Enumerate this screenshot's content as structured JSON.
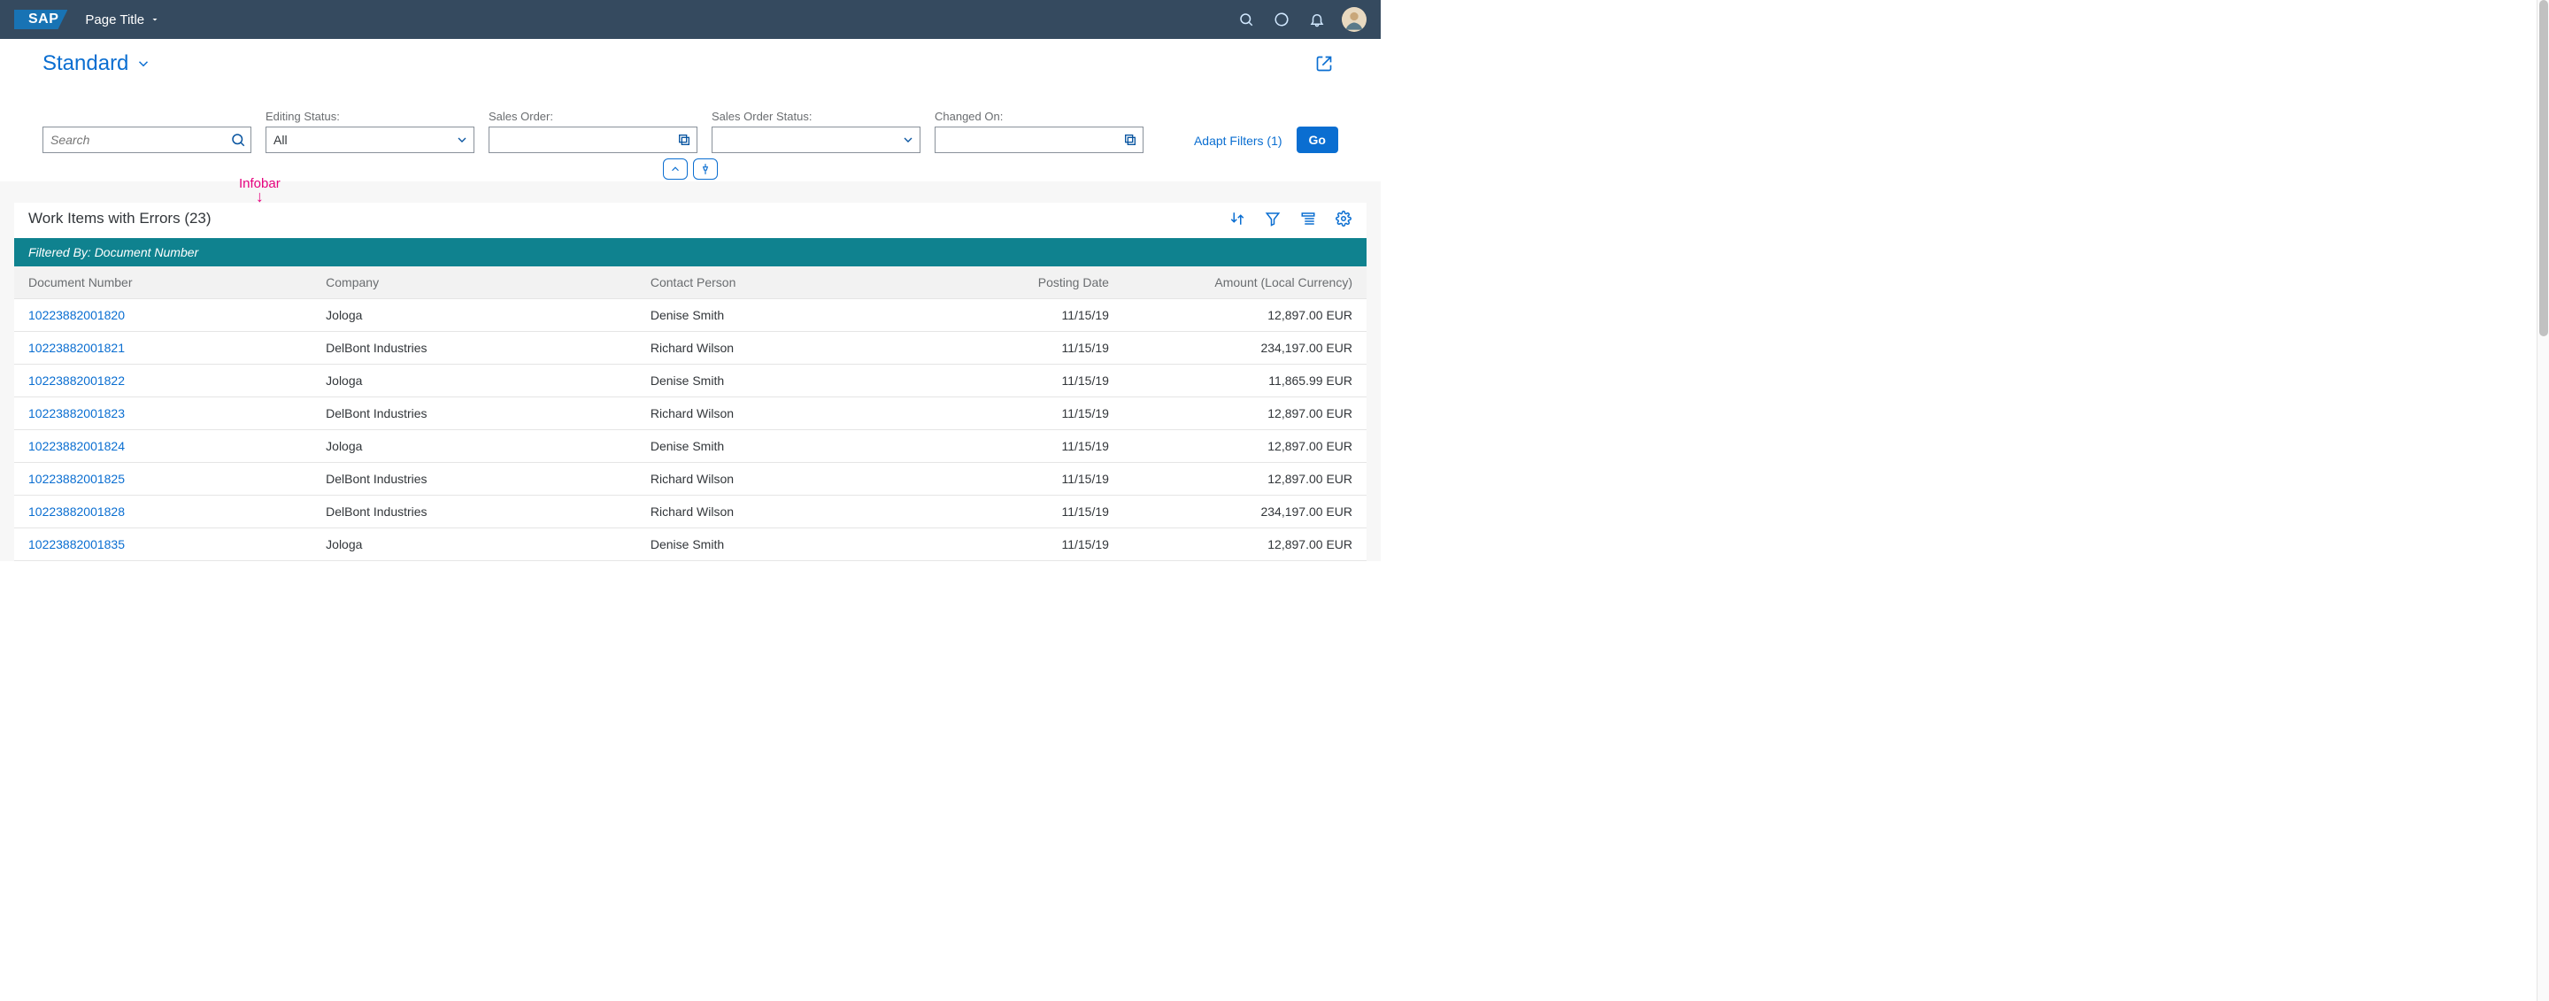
{
  "shell": {
    "logo_text": "SAP",
    "page_title": "Page Title"
  },
  "header": {
    "variant": "Standard",
    "adapt_filters": "Adapt Filters (1)",
    "go": "Go"
  },
  "filters": {
    "search_placeholder": "Search",
    "editing_status_label": "Editing Status:",
    "editing_status_value": "All",
    "sales_order_label": "Sales Order:",
    "sales_order_status_label": "Sales Order Status:",
    "changed_on_label": "Changed On:"
  },
  "annotation": {
    "label": "Infobar"
  },
  "table": {
    "title": "Work Items with Errors (23)",
    "infobar": "Filtered By: Document Number",
    "columns": {
      "doc": "Document Number",
      "company": "Company",
      "contact": "Contact Person",
      "date": "Posting Date",
      "amount": "Amount (Local Currency)"
    },
    "rows": [
      {
        "doc": "10223882001820",
        "company": "Jologa",
        "contact": "Denise Smith",
        "date": "11/15/19",
        "amount": "12,897.00 EUR"
      },
      {
        "doc": "10223882001821",
        "company": "DelBont Industries",
        "contact": "Richard Wilson",
        "date": "11/15/19",
        "amount": "234,197.00 EUR"
      },
      {
        "doc": "10223882001822",
        "company": "Jologa",
        "contact": "Denise Smith",
        "date": "11/15/19",
        "amount": "11,865.99 EUR"
      },
      {
        "doc": "10223882001823",
        "company": "DelBont Industries",
        "contact": "Richard Wilson",
        "date": "11/15/19",
        "amount": "12,897.00 EUR"
      },
      {
        "doc": "10223882001824",
        "company": "Jologa",
        "contact": "Denise Smith",
        "date": "11/15/19",
        "amount": "12,897.00 EUR"
      },
      {
        "doc": "10223882001825",
        "company": "DelBont Industries",
        "contact": "Richard Wilson",
        "date": "11/15/19",
        "amount": "12,897.00 EUR"
      },
      {
        "doc": "10223882001828",
        "company": "DelBont Industries",
        "contact": "Richard Wilson",
        "date": "11/15/19",
        "amount": "234,197.00 EUR"
      },
      {
        "doc": "10223882001835",
        "company": "Jologa",
        "contact": "Denise Smith",
        "date": "11/15/19",
        "amount": "12,897.00 EUR"
      }
    ]
  }
}
